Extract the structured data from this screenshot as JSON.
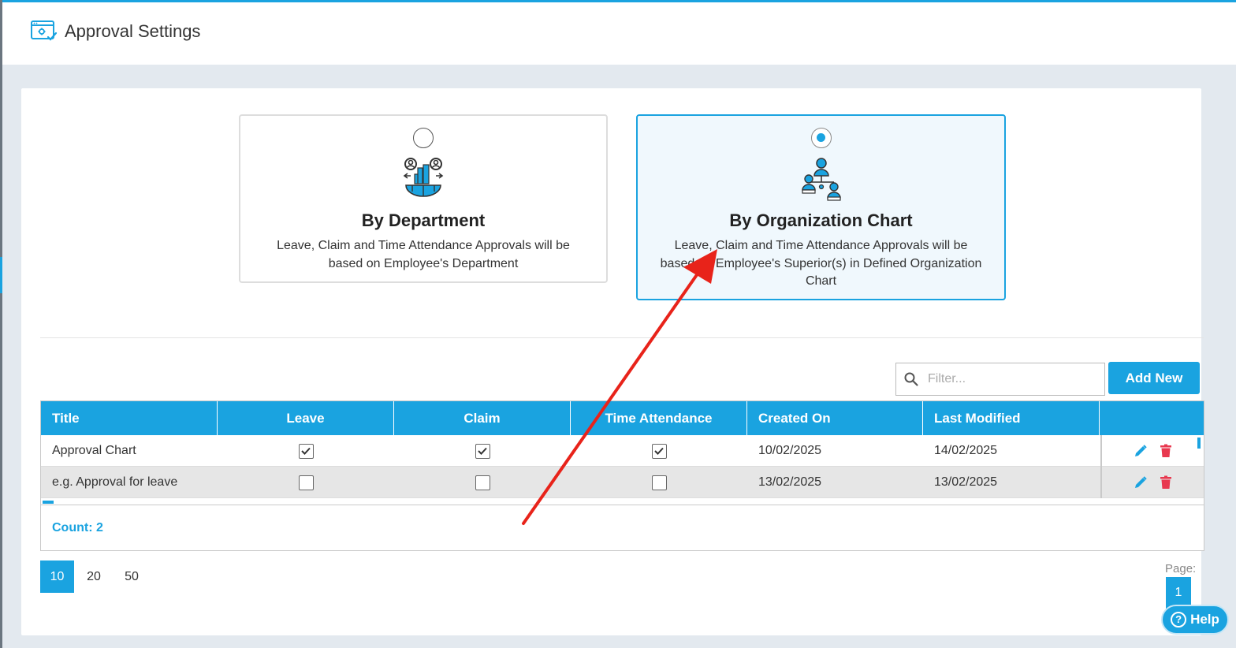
{
  "header": {
    "title": "Approval Settings",
    "icon": "settings-window-icon"
  },
  "options": [
    {
      "title": "By Department",
      "desc": "Leave, Claim and Time Attendance Approvals will be based on Employee's Department",
      "selected": false,
      "icon": "department-icon"
    },
    {
      "title": "By Organization Chart",
      "desc": "Leave, Claim and Time Attendance Approvals will be based on Employee's Superior(s) in Defined Organization Chart",
      "selected": true,
      "icon": "org-chart-icon"
    }
  ],
  "toolbar": {
    "filter_placeholder": "Filter...",
    "add_label": "Add New"
  },
  "grid": {
    "columns": [
      "Title",
      "Leave",
      "Claim",
      "Time Attendance",
      "Created On",
      "Last Modified",
      ""
    ],
    "rows": [
      {
        "title": "Approval Chart",
        "leave": true,
        "claim": true,
        "time_attendance": true,
        "created_on": "10/02/2025",
        "last_modified": "14/02/2025"
      },
      {
        "title": "e.g. Approval for leave",
        "leave": false,
        "claim": false,
        "time_attendance": false,
        "created_on": "13/02/2025",
        "last_modified": "13/02/2025"
      }
    ],
    "count_label": "Count: 2"
  },
  "pagination": {
    "sizes": [
      "10",
      "20",
      "50"
    ],
    "active_size": "10",
    "page_label": "Page:",
    "current_page": "1"
  },
  "help": {
    "label": "Help",
    "glyph": "?"
  },
  "colors": {
    "accent": "#1aa3e0",
    "delete": "#e8384f",
    "annotation_arrow": "#e8231a"
  }
}
